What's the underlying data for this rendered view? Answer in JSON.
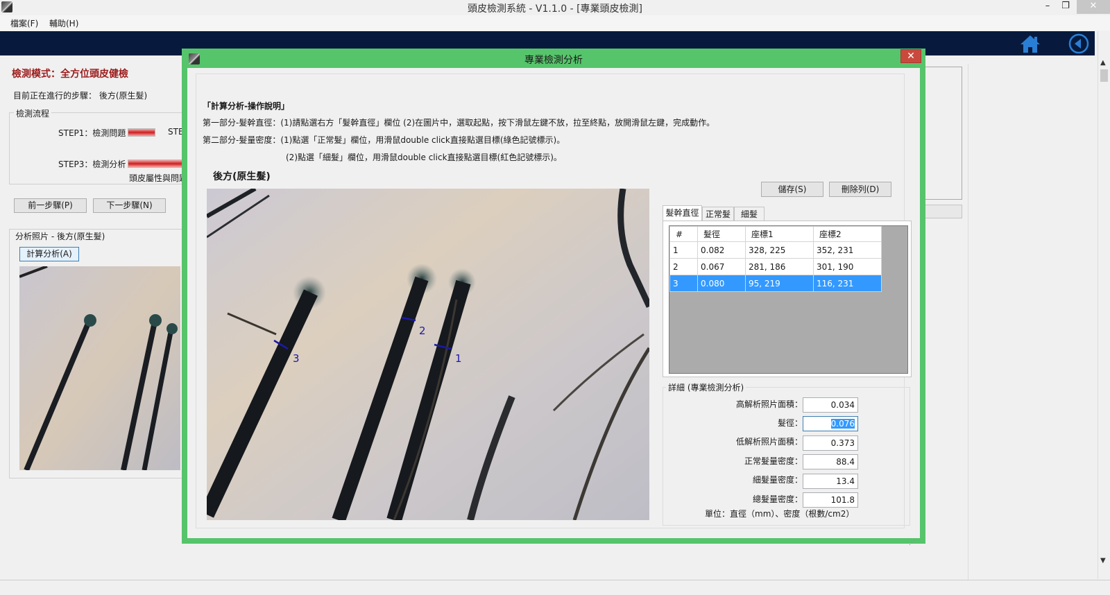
{
  "window": {
    "title": "頭皮檢測系統 - V1.1.0 - [專業頭皮檢測]",
    "minimize": "–",
    "restore": "❐",
    "close": "✕"
  },
  "menu": [
    {
      "label": "檔案(F)"
    },
    {
      "label": "輔助(H)"
    }
  ],
  "navbar": {
    "home_icon": "home-icon",
    "back_icon": "back-circle-icon",
    "color": "#071a3d"
  },
  "left_panel": {
    "mode_title": "檢測模式：全方位頭皮健檢",
    "current_step": "目前正在進行的步驟： 後方(原生髮)",
    "flow_legend": "檢測流程",
    "steps": {
      "step1": "STEP1：檢測問題",
      "step2_partial": "STE",
      "step3": "STEP3：檢測分析",
      "step3_sub": "頭皮屬性與問題"
    },
    "prev_button": "前一步驟(P)",
    "next_button": "下一步驟(N)",
    "photo_title": "分析照片 - 後方(原生髮)",
    "calc_button": "計算分析(A)"
  },
  "dialog": {
    "title": "專業檢測分析",
    "close": "✕",
    "border_color": "#56c46b",
    "instructions": {
      "heading": "「計算分析-操作說明」",
      "line1": "第一部分-髮幹直徑：(1)請點選右方「髮幹直徑」欄位 (2)在圖片中，選取起點，按下滑鼠左鍵不放，拉至終點，放開滑鼠左鍵，完成動作。",
      "line2": "第二部分-髮量密度：(1)點選「正常髮」欄位，用滑鼠double click直接點選目標(綠色記號標示)。",
      "line3": "(2)點選「細髮」欄位，用滑鼠double click直接點選目標(紅色記號標示)。"
    },
    "photo_caption": "後方(原生髮)",
    "markers": [
      {
        "label": "1",
        "color": "#1a1aa8"
      },
      {
        "label": "2",
        "color": "#1a1aa8"
      },
      {
        "label": "3",
        "color": "#1a1aa8"
      }
    ],
    "save_button": "儲存(S)",
    "delete_button": "刪除列(D)",
    "tabs": [
      {
        "label": "髮幹直徑",
        "active": true
      },
      {
        "label": "正常髮",
        "active": false
      },
      {
        "label": "細髮",
        "active": false
      }
    ],
    "table": {
      "headers": [
        "#",
        "髮徑",
        "座標1",
        "座標2"
      ],
      "rows": [
        [
          "1",
          "0.082",
          "328, 225",
          "352, 231"
        ],
        [
          "2",
          "0.067",
          "281, 186",
          "301, 190"
        ],
        [
          "3",
          "0.080",
          "95, 219",
          "116, 231"
        ]
      ],
      "selected_row": 3
    },
    "details": {
      "legend": "詳細 (專業檢測分析)",
      "fields": [
        {
          "label": "高解析照片面積：",
          "value": "0.034"
        },
        {
          "label": "髮徑：",
          "value": "0.076"
        },
        {
          "label": "低解析照片面積：",
          "value": "0.373"
        },
        {
          "label": "正常髮量密度：",
          "value": "88.4"
        },
        {
          "label": "細髮量密度：",
          "value": "13.4"
        },
        {
          "label": "總髮量密度：",
          "value": "101.8"
        }
      ],
      "unit_note": "單位：直徑（mm）、密度（根數/cm2）"
    }
  }
}
